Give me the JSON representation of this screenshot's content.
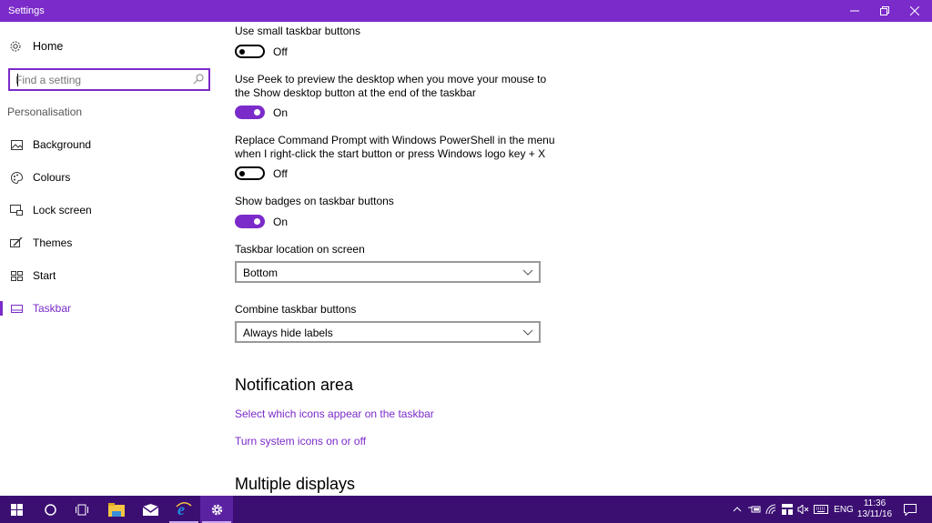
{
  "window": {
    "title": "Settings",
    "minimize_icon": "minimize-icon",
    "maximize_icon": "restore-icon",
    "close_icon": "close-icon"
  },
  "colors": {
    "accent": "#7b2bc9",
    "taskbar": "#3b0e72",
    "link": "#7b2bc9"
  },
  "sidebar": {
    "home_label": "Home",
    "search_placeholder": "Find a setting",
    "group_label": "Personalisation",
    "items": [
      {
        "label": "Background",
        "icon": "picture-icon"
      },
      {
        "label": "Colours",
        "icon": "palette-icon"
      },
      {
        "label": "Lock screen",
        "icon": "lock-screen-icon"
      },
      {
        "label": "Themes",
        "icon": "themes-icon"
      },
      {
        "label": "Start",
        "icon": "start-icon"
      },
      {
        "label": "Taskbar",
        "icon": "taskbar-icon",
        "active": true
      }
    ]
  },
  "main": {
    "settings": [
      {
        "label": "Use small taskbar buttons",
        "state": "Off"
      },
      {
        "label_line1": "Use Peek to preview the desktop when you move your mouse to",
        "label_line2": "the Show desktop button at the end of the taskbar",
        "state": "On"
      },
      {
        "label_line1": "Replace Command Prompt with Windows PowerShell in the menu",
        "label_line2": "when I right-click the start button or press Windows logo key + X",
        "state": "Off"
      },
      {
        "label": "Show badges on taskbar buttons",
        "state": "On"
      }
    ],
    "location": {
      "label": "Taskbar location on screen",
      "value": "Bottom"
    },
    "combine": {
      "label": "Combine taskbar buttons",
      "value": "Always hide labels"
    },
    "notification_heading": "Notification area",
    "links": [
      "Select which icons appear on the taskbar",
      "Turn system icons on or off"
    ],
    "multiple_displays_heading": "Multiple displays"
  },
  "taskbar": {
    "apps": [
      "start-icon",
      "cortana-icon",
      "task-view-icon",
      "file-explorer-icon",
      "mail-icon",
      "edge-icon",
      "settings-icon"
    ],
    "tray": {
      "language": "ENG",
      "time": "11:36",
      "date": "13/11/16"
    }
  }
}
